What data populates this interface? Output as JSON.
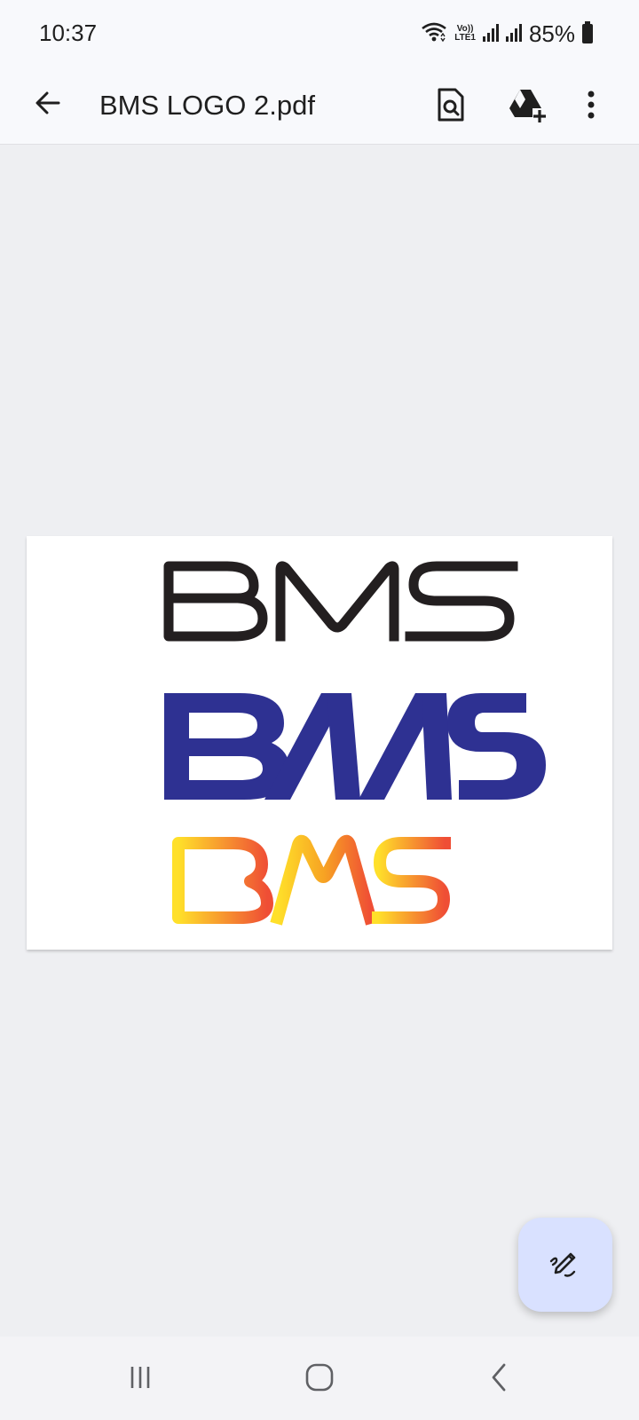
{
  "status_bar": {
    "time": "10:37",
    "battery_percent": "85%",
    "network_label_top": "Vo))",
    "network_label_bottom": "LTE1",
    "icons": [
      "wifi-icon",
      "signal-icon",
      "signal-icon",
      "battery-icon"
    ]
  },
  "app_bar": {
    "title": "BMS LOGO 2.pdf",
    "icons": [
      "back-arrow-icon",
      "find-in-page-icon",
      "add-to-drive-icon",
      "more-vert-icon"
    ]
  },
  "document": {
    "logos": [
      {
        "text": "BMS",
        "color": "#231f20"
      },
      {
        "text": "BMS",
        "color": "#2e3192"
      },
      {
        "text": "BMS",
        "gradient": [
          "#ffe02a",
          "#f7a323",
          "#ef4e35"
        ]
      }
    ]
  },
  "fab": {
    "icon": "edit-pen-icon",
    "color": "#d9e1ff"
  },
  "nav_bar": {
    "icons": [
      "recents-icon",
      "home-icon",
      "back-icon"
    ]
  }
}
